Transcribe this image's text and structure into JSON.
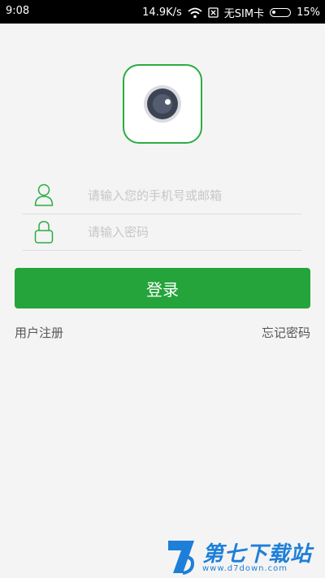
{
  "status_bar": {
    "time": "9:08",
    "network_speed": "14.9K/s",
    "sim_status": "无SIM卡",
    "battery_percent": "15%"
  },
  "login": {
    "account_placeholder": "请输入您的手机号或邮箱",
    "password_placeholder": "请输入密码",
    "submit_label": "登录",
    "register_label": "用户注册",
    "forgot_label": "忘记密码"
  },
  "watermark": {
    "title": "第七下载站",
    "url": "www.d7down.com"
  },
  "colors": {
    "accent": "#24a43a",
    "background": "#f4f4f4",
    "watermark": "#1d7fd8"
  }
}
